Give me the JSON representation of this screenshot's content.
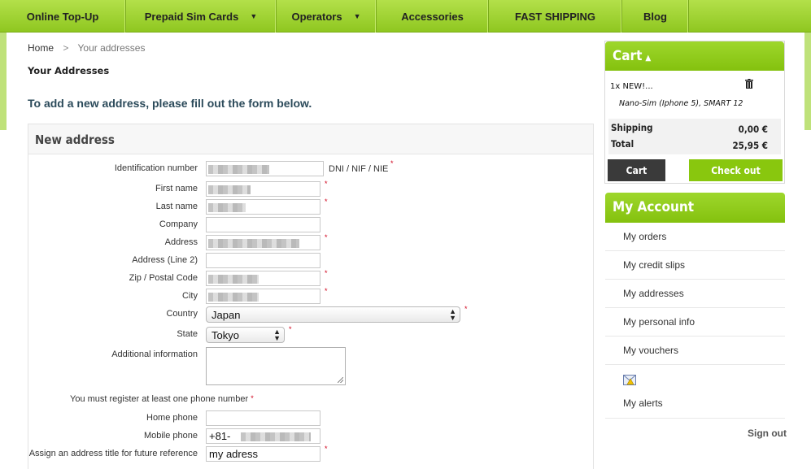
{
  "nav": {
    "items": [
      {
        "label": "Online Top-Up",
        "has_caret": false
      },
      {
        "label": "Prepaid Sim Cards",
        "has_caret": true
      },
      {
        "label": "Operators",
        "has_caret": true
      },
      {
        "label": "Accessories",
        "has_caret": false
      },
      {
        "label": "FAST SHIPPING",
        "has_caret": false
      },
      {
        "label": "Blog",
        "has_caret": false
      }
    ],
    "caret_icon": "caret-down-icon"
  },
  "breadcrumb": {
    "home": "Home",
    "separator": ">",
    "current": "Your addresses"
  },
  "page_title": "Your Addresses",
  "intro": "To add a new address, please fill out the form below.",
  "form": {
    "heading": "New address",
    "required_mark": "*",
    "fields": {
      "identification_number": {
        "label": "Identification number",
        "hint": "DNI / NIF / NIE"
      },
      "first_name": {
        "label": "First name"
      },
      "last_name": {
        "label": "Last name"
      },
      "company": {
        "label": "Company"
      },
      "address": {
        "label": "Address"
      },
      "address2": {
        "label": "Address (Line 2)"
      },
      "zip": {
        "label": "Zip / Postal Code"
      },
      "city": {
        "label": "City"
      },
      "country": {
        "label": "Country",
        "value": "Japan"
      },
      "state": {
        "label": "State",
        "value": "Tokyo"
      },
      "additional_info": {
        "label": "Additional information"
      },
      "phone_note": "You must register at least one phone number",
      "home_phone": {
        "label": "Home phone"
      },
      "mobile_phone": {
        "label": "Mobile phone",
        "value": "+81-"
      },
      "alias": {
        "label": "Assign an address title for future reference",
        "value": "my adress"
      }
    }
  },
  "cart": {
    "title": "Cart",
    "toggle_icon": "caret-up-icon",
    "item_name": "1x NEW!...",
    "item_desc": "Nano-Sim (Iphone 5), SMART 12",
    "remove_icon": "trash-icon",
    "shipping_label": "Shipping",
    "shipping_value": "0,00 €",
    "total_label": "Total",
    "total_value": "25,95 €",
    "cart_button": "Cart",
    "checkout_button": "Check out"
  },
  "account": {
    "title": "My Account",
    "items": [
      "My orders",
      "My credit slips",
      "My addresses",
      "My personal info",
      "My vouchers"
    ],
    "alerts_icon": "envelope-alert-icon",
    "alerts_label": "My alerts",
    "signout": "Sign out"
  },
  "colors": {
    "brand_green": "#8fc720",
    "required_red": "#d0021b",
    "dark_button": "#3a3a3a"
  }
}
